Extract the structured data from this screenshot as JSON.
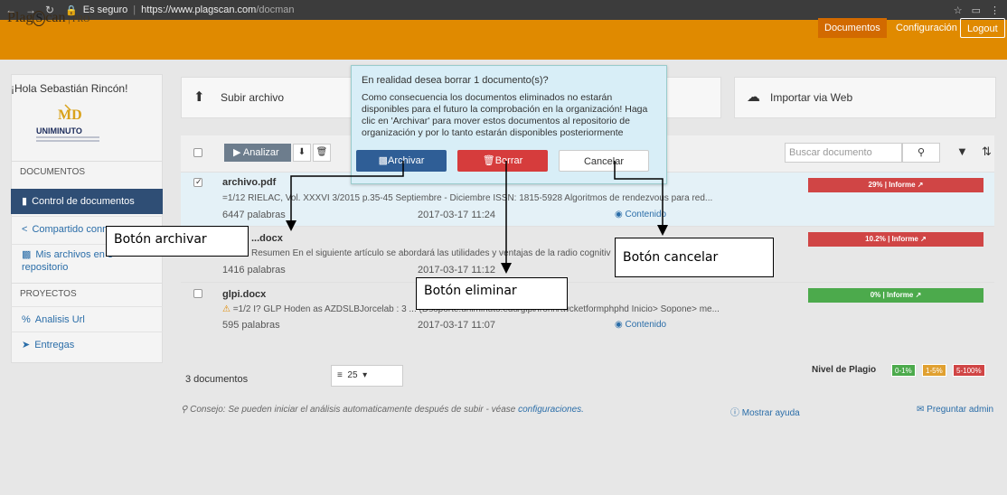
{
  "browser": {
    "secure_label": "Es seguro",
    "url_host": "https://www.plagscan.com",
    "url_path": "/docman"
  },
  "header": {
    "logo_a": "Plag",
    "logo_s": "S",
    "logo_b": "can",
    "logo_pro": "| PRO",
    "nav_documents": "Documentos",
    "nav_config": "Configuración",
    "nav_logout": "Logout"
  },
  "sidebar": {
    "greeting": "¡Hola Sebastián Rincón!",
    "uni_name": "UNIMINUTO",
    "section_docs": "DOCUMENTOS",
    "item_control": "Control de documentos",
    "item_shared": "Compartido conm",
    "item_mine_1": "Mis archivos en e",
    "item_mine_2": "repositorio",
    "section_projects": "PROYECTOS",
    "item_url": "Analisis Url",
    "item_deliveries": "Entregas"
  },
  "actions": {
    "upload": "Subir archivo",
    "web_import": "Importar via Web"
  },
  "toolbar": {
    "analyze": "Analizar",
    "search_placeholder": "Buscar documento"
  },
  "documents": [
    {
      "name": "archivo.pdf",
      "snippet": "=1/12 RIELAC, Vol. XXXVI 3/2015 p.35-45 Septiembre - Diciembre ISSN: 1815-5928 Algoritmos de rendezvous para red...",
      "words": "6447 palabras",
      "date": "2017-03-17 11:24",
      "content": "Contenido",
      "score": "29% | Informe",
      "score_color": "#d04545"
    },
    {
      "name": "...docx",
      "snippet": "Resumen En el siguiente artículo se abordará las utilidades y ventajas de la radio cognitiv",
      "words": "1416 palabras",
      "date": "2017-03-17 11:12",
      "content": "",
      "score": "10.2% | Informe",
      "score_color": "#d04545"
    },
    {
      "name": "glpi.docx",
      "snippet": "=1/2 I? GLP Hoden as AZDSLBJorcelab : 3 ... (Dsoporte.uniminuto.edu/glpi/fronh/twcketformphphd Inicio> Sopone> me...",
      "words": "595 palabras",
      "date": "2017-03-17 11:07",
      "content": "Contenido",
      "score": "0% | Informe",
      "score_color": "#4caa4c"
    }
  ],
  "footer": {
    "count": "3 documentos",
    "page_size": "25",
    "nivel": "Nivel de Plagio",
    "lvl1": "0-1%",
    "lvl2": "1-5%",
    "lvl3": "5-100%",
    "tip_text": "Consejo: Se pueden iniciar el análisis automaticamente después de subir - véase ",
    "tip_link": "configuraciones.",
    "help": "Mostrar ayuda",
    "admin": "Preguntar admin"
  },
  "popover": {
    "question": "En realidad desea borrar 1 documento(s)?",
    "message": "Como consecuencia los documentos eliminados no estarán disponibles para el futuro la comprobación en la organización! Haga clic en 'Archivar' para mover estos documentos al repositorio de organización y por lo tanto estarán disponibles posteriormente",
    "archive": "Archivar",
    "delete": "Borrar",
    "cancel": "Cancelar"
  },
  "annotations": {
    "archive": "Botón archivar",
    "delete": "Botón eliminar",
    "cancel": "Botón cancelar"
  },
  "colors": {
    "brand_orange": "#e08a00",
    "active_nav": "#2f4e75",
    "archive_btn": "#2f5e96",
    "delete_btn": "#d63c3c"
  }
}
